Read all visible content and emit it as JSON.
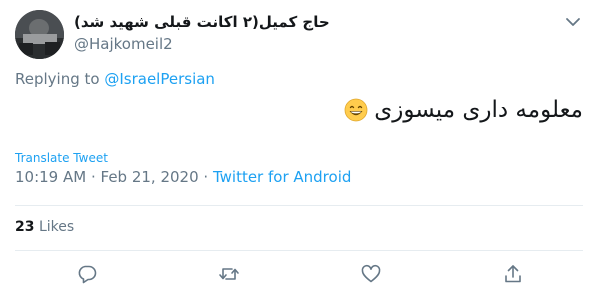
{
  "author": {
    "name": "حاج کمیل(۲ اکانت قبلی شهید شد)",
    "handle": "@Hajkomeil2"
  },
  "replying": {
    "prefix": "Replying to",
    "handle": "@IsraelPersian"
  },
  "tweet": {
    "text": "معلومه داری میسوزی",
    "emoji": "grinning-face-with-smiling-eyes"
  },
  "translate_label": "Translate Tweet",
  "meta": {
    "time": "10:19 AM",
    "separator": " · ",
    "date": "Feb 21, 2020",
    "source": "Twitter for Android"
  },
  "likes": {
    "count": "23",
    "label": "Likes"
  },
  "colors": {
    "accent": "#1da1f2",
    "muted": "#657786",
    "text": "#14171a"
  },
  "icons": {
    "reply": "reply-icon",
    "retweet": "retweet-icon",
    "like": "heart-icon",
    "share": "share-icon",
    "menu": "chevron-down-icon"
  }
}
